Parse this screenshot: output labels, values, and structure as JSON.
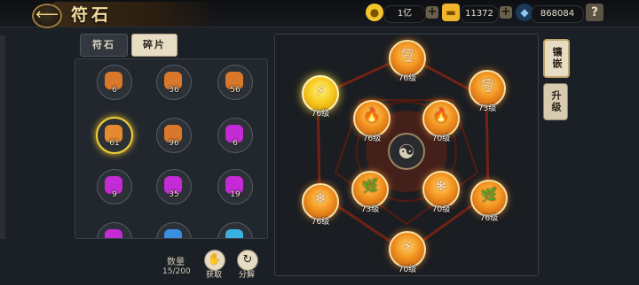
{
  "header": {
    "title": "符石",
    "back_icon": "back-arrow-icon",
    "currency": [
      {
        "icon": "coin-icon",
        "value": "1亿",
        "color": "#f2c52b"
      },
      {
        "icon": "ingot-icon",
        "value": "11372",
        "color": "#f0b52a"
      },
      {
        "icon": "diamond-icon",
        "value": "868084",
        "color": "#8fc7f2"
      }
    ],
    "plus_label": "+",
    "help_label": "?"
  },
  "tabs": {
    "runestone": "符石",
    "fragment": "碎片",
    "selected": "fragment"
  },
  "fragments": [
    {
      "count": "6",
      "color": "#d9782a"
    },
    {
      "count": "36",
      "color": "#d9782a"
    },
    {
      "count": "56",
      "color": "#d9782a"
    },
    {
      "count": "61",
      "color": "#e58a2e",
      "selected": true
    },
    {
      "count": "96",
      "color": "#d9782a"
    },
    {
      "count": "6",
      "color": "#c42ad6"
    },
    {
      "count": "9",
      "color": "#c42ad6"
    },
    {
      "count": "35",
      "color": "#c42ad6"
    },
    {
      "count": "19",
      "color": "#c42ad6"
    },
    {
      "count": "",
      "color": "#c42ad6"
    },
    {
      "count": "",
      "color": "#3a8fe0"
    },
    {
      "count": "",
      "color": "#3ab0e0"
    }
  ],
  "footer": {
    "quantity_label": "数量",
    "quantity_value": "15/200",
    "obtain_label": "获取",
    "decompose_label": "分解"
  },
  "side_buttons": {
    "inlay": "镶嵌",
    "upgrade": "升级"
  },
  "runes": [
    {
      "glyph": "🌪",
      "level": "76级"
    },
    {
      "glyph": "⚡",
      "level": "76级",
      "highlight": true
    },
    {
      "glyph": "🌪",
      "level": "73级"
    },
    {
      "glyph": "🔥",
      "level": "76级"
    },
    {
      "glyph": "🔥",
      "level": "70级"
    },
    {
      "glyph": "❄",
      "level": "76级"
    },
    {
      "glyph": "🌿",
      "level": "73级"
    },
    {
      "glyph": "❄",
      "level": "70级"
    },
    {
      "glyph": "🌿",
      "level": "76级"
    },
    {
      "glyph": "⚡",
      "level": "70级"
    }
  ],
  "center_symbol": "☯"
}
